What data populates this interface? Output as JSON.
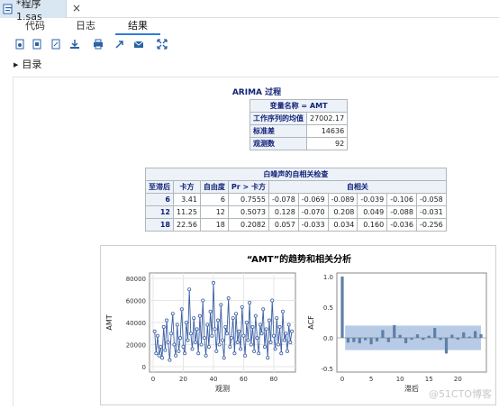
{
  "window": {
    "tab_title": "*程序 1.sas",
    "close_glyph": "×"
  },
  "subtabs": [
    "代码",
    "日志",
    "结果"
  ],
  "toolbar_icons": [
    "new-icon",
    "open-icon",
    "save-icon",
    "download-icon",
    "print-icon",
    "export-icon",
    "email-icon",
    "expand-icon"
  ],
  "outline": {
    "label": "目录"
  },
  "proc_title": "ARIMA 过程",
  "summary_table": {
    "header": "变量名称 = AMT",
    "rows": [
      {
        "label": "工作序列的均值",
        "value": "27002.17"
      },
      {
        "label": "标准差",
        "value": "14636"
      },
      {
        "label": "观测数",
        "value": "92"
      }
    ]
  },
  "wn_table": {
    "title": "白噪声的自相关检查",
    "columns": [
      "至滞后",
      "卡方",
      "自由度",
      "Pr > 卡方",
      "自相关"
    ],
    "rows": [
      {
        "lag": "6",
        "chisq": "3.41",
        "df": "6",
        "p": "0.7555",
        "ac": [
          "-0.078",
          "-0.069",
          "-0.089",
          "-0.039",
          "-0.106",
          "-0.058"
        ]
      },
      {
        "lag": "12",
        "chisq": "11.25",
        "df": "12",
        "p": "0.5073",
        "ac": [
          "0.128",
          "-0.070",
          "0.208",
          "0.049",
          "-0.088",
          "-0.031"
        ]
      },
      {
        "lag": "18",
        "chisq": "22.56",
        "df": "18",
        "p": "0.2082",
        "ac": [
          "0.057",
          "-0.033",
          "0.034",
          "0.160",
          "-0.036",
          "-0.256"
        ]
      }
    ]
  },
  "chart_title": "“AMT”的趋势和相关分析",
  "chart_data": [
    {
      "type": "line",
      "xlabel": "观测",
      "ylabel": "AMT",
      "xlim": [
        0,
        92
      ],
      "ylim": [
        0,
        80000
      ],
      "xticks": [
        "0",
        "20",
        "40",
        "60",
        "80"
      ],
      "yticks": [
        "0",
        "20000",
        "40000",
        "60000",
        "80000"
      ],
      "x": [
        1,
        2,
        3,
        4,
        5,
        6,
        7,
        8,
        9,
        10,
        11,
        12,
        13,
        14,
        15,
        16,
        17,
        18,
        19,
        20,
        21,
        22,
        23,
        24,
        25,
        26,
        27,
        28,
        29,
        30,
        31,
        32,
        33,
        34,
        35,
        36,
        37,
        38,
        39,
        40,
        41,
        42,
        43,
        44,
        45,
        46,
        47,
        48,
        49,
        50,
        51,
        52,
        53,
        54,
        55,
        56,
        57,
        58,
        59,
        60,
        61,
        62,
        63,
        64,
        65,
        66,
        67,
        68,
        69,
        70,
        71,
        72,
        73,
        74,
        75,
        76,
        77,
        78,
        79,
        80,
        81,
        82,
        83,
        84,
        85,
        86,
        87,
        88,
        89,
        90,
        91,
        92
      ],
      "y": [
        32000,
        12000,
        28000,
        10000,
        18000,
        8000,
        36000,
        15000,
        42000,
        22000,
        6000,
        30000,
        48000,
        20000,
        10000,
        38000,
        14000,
        26000,
        52000,
        18000,
        12000,
        40000,
        24000,
        70000,
        30000,
        16000,
        44000,
        22000,
        34000,
        12000,
        46000,
        20000,
        60000,
        26000,
        10000,
        38000,
        18000,
        50000,
        28000,
        76000,
        34000,
        14000,
        42000,
        20000,
        56000,
        24000,
        8000,
        36000,
        30000,
        62000,
        18000,
        26000,
        44000,
        12000,
        48000,
        22000,
        32000,
        16000,
        54000,
        28000,
        10000,
        40000,
        24000,
        58000,
        20000,
        36000,
        14000,
        46000,
        26000,
        12000,
        38000,
        30000,
        52000,
        18000,
        34000,
        8000,
        42000,
        22000,
        60000,
        28000,
        16000,
        44000,
        20000,
        36000,
        12000,
        50000,
        24000,
        30000,
        14000,
        38000,
        22000,
        32000
      ]
    },
    {
      "type": "bar",
      "xlabel": "滞后",
      "ylabel": "ACF",
      "xlim": [
        0,
        24
      ],
      "ylim": [
        -0.5,
        1.0
      ],
      "xticks": [
        "0",
        "5",
        "10",
        "15",
        "20"
      ],
      "yticks": [
        "-0.5",
        "0.0",
        "0.5",
        "1.0"
      ],
      "lags": [
        0,
        1,
        2,
        3,
        4,
        5,
        6,
        7,
        8,
        9,
        10,
        11,
        12,
        13,
        14,
        15,
        16,
        17,
        18,
        19,
        20,
        21,
        22,
        23,
        24
      ],
      "values": [
        1.0,
        -0.078,
        -0.069,
        -0.089,
        -0.039,
        -0.106,
        -0.058,
        0.128,
        -0.07,
        0.208,
        0.049,
        -0.088,
        -0.031,
        0.057,
        -0.033,
        0.034,
        0.16,
        -0.036,
        -0.256,
        0.05,
        -0.03,
        0.09,
        0.02,
        0.11,
        0.06
      ],
      "band": 0.2
    }
  ],
  "watermark": "@51CTO博客"
}
